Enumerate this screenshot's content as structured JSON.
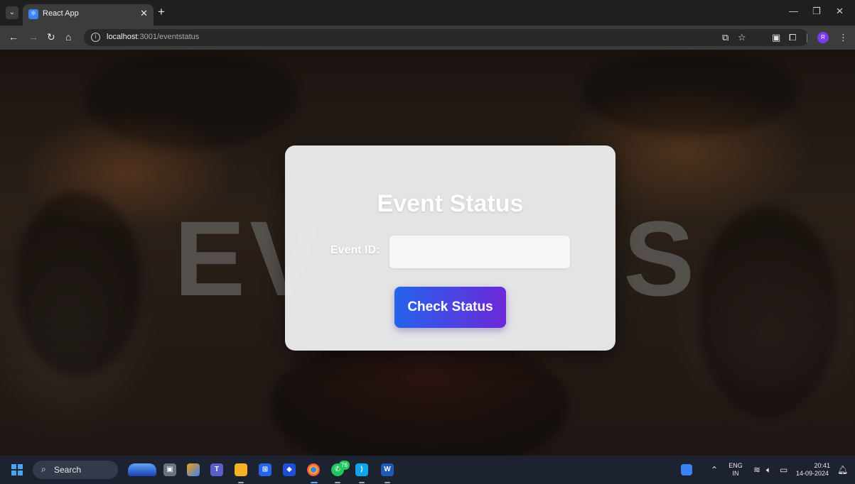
{
  "browser": {
    "tab_title": "React App",
    "url_host": "localhost",
    "url_path": ":3001/eventstatus"
  },
  "page": {
    "background_text_left": "EV",
    "background_text_right": "S",
    "title": "Event Status",
    "event_id_label": "Event ID:",
    "event_id_value": "",
    "submit_label": "Check Status",
    "accent_gradient": [
      "#2563eb",
      "#6d28d9"
    ]
  },
  "taskbar": {
    "search_label": "Search",
    "whatsapp_badge": "76",
    "language_line1": "ENG",
    "language_line2": "IN",
    "time": "20:41",
    "date": "14-09-2024"
  },
  "icons": {
    "taskbar_apps": [
      "weather-icon",
      "task-view-icon",
      "copilot-icon",
      "teams-icon",
      "file-explorer-icon",
      "microsoft-store-icon",
      "app-icon",
      "chrome-icon",
      "whatsapp-icon",
      "vscode-icon",
      "word-icon"
    ]
  }
}
